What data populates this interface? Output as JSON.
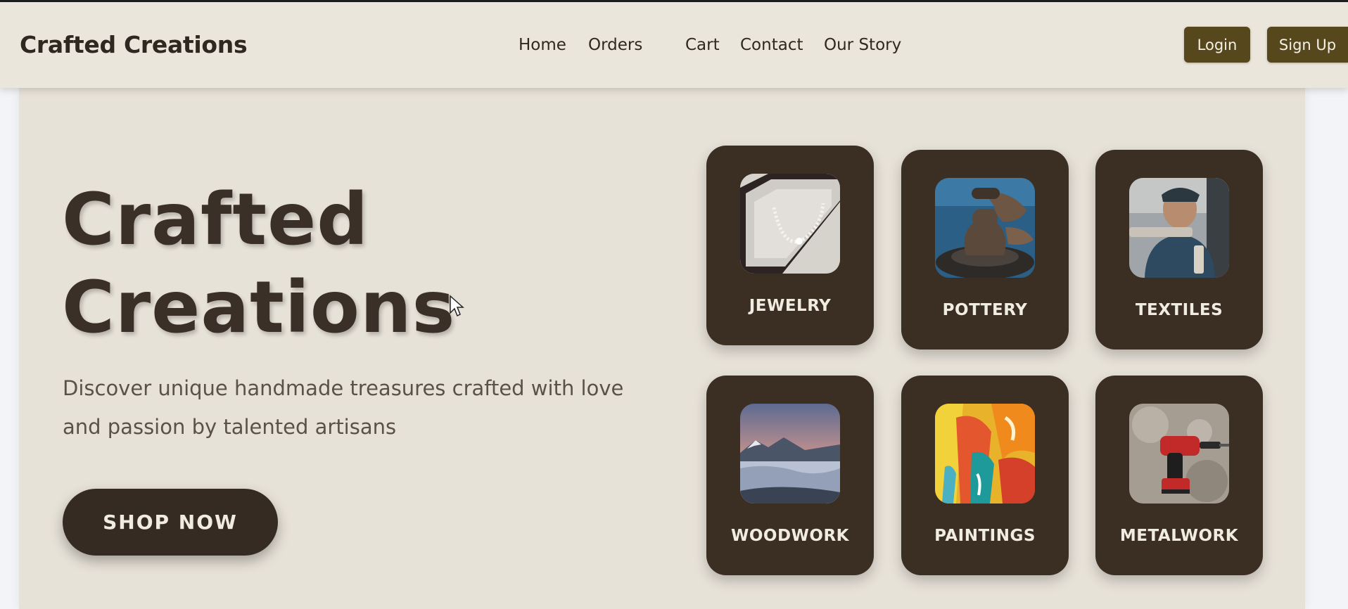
{
  "navbar": {
    "brand": "Crafted Creations",
    "links": [
      "Home",
      "Orders",
      "Cart",
      "Contact",
      "Our Story"
    ],
    "login_label": "Login",
    "signup_label": "Sign Up",
    "button_color": "#56471d"
  },
  "hero": {
    "title_line1": "Crafted",
    "title_line2": "Creations",
    "subtitle": "Discover unique handmade treasures crafted with love and passion by talented artisans",
    "cta_label": "SHOP NOW"
  },
  "categories": [
    {
      "label": "JEWELRY",
      "icon": "pearl-necklace-image"
    },
    {
      "label": "POTTERY",
      "icon": "pottery-wheel-image"
    },
    {
      "label": "TEXTILES",
      "icon": "craftsman-image"
    },
    {
      "label": "WOODWORK",
      "icon": "mountain-landscape-image"
    },
    {
      "label": "PAINTINGS",
      "icon": "abstract-paint-image"
    },
    {
      "label": "METALWORK",
      "icon": "power-drill-image"
    }
  ],
  "colors": {
    "background": "#e7e2d8",
    "card": "#3b2f24",
    "text": "#2f2820"
  }
}
